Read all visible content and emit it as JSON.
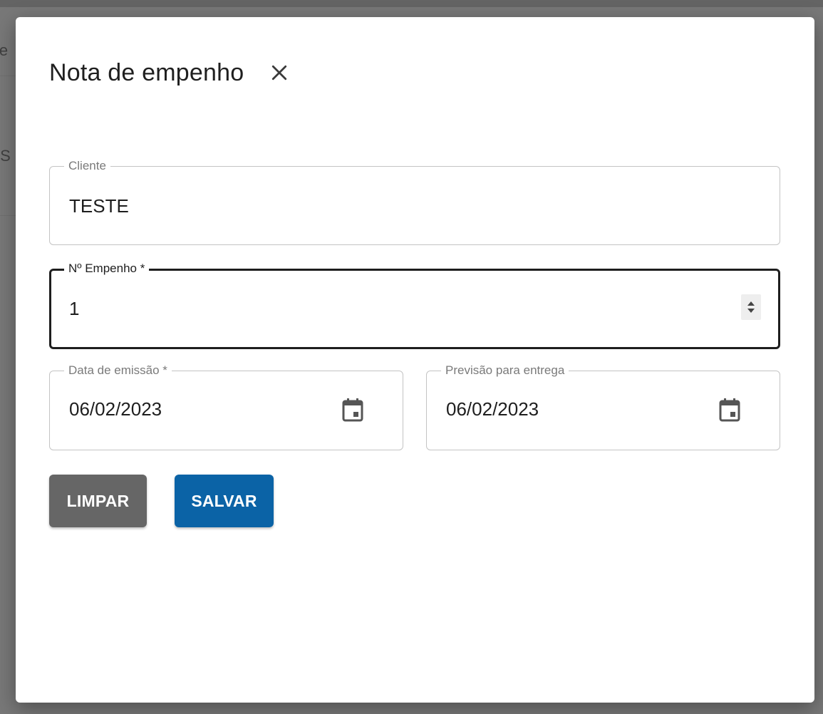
{
  "backdrop": {
    "text_1": "ie",
    "text_2": ":S"
  },
  "dialog": {
    "title": "Nota de empenho",
    "close_icon": "close-icon"
  },
  "form": {
    "cliente": {
      "label": "Cliente",
      "value": "TESTE"
    },
    "empenho": {
      "label": "Nº Empenho *",
      "value": "1"
    },
    "data_emissao": {
      "label": "Data de emissão *",
      "value": "06/02/2023"
    },
    "previsao_entrega": {
      "label": "Previsão para entrega",
      "value": "06/02/2023"
    }
  },
  "actions": {
    "clear_label": "LIMPAR",
    "save_label": "SALVAR"
  },
  "colors": {
    "save_button": "#0b63a6",
    "clear_button": "#666666",
    "focused_border": "#1e1e1e"
  }
}
